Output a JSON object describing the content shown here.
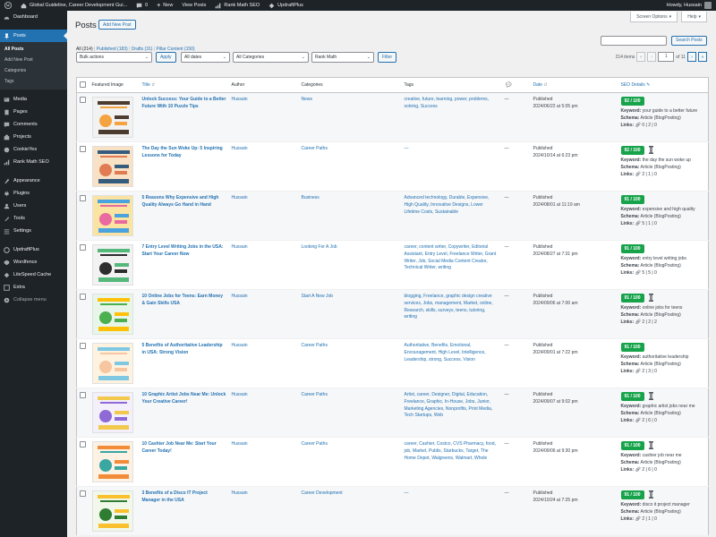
{
  "admin_bar": {
    "site_title": "Global Guideline, Career Development Gui...",
    "comments_count": "0",
    "new_label": "New",
    "view_posts_label": "View Posts",
    "rank_math_label": "Rank Math SEO",
    "updraft_label": "UpdraftPlus",
    "howdy": "Howdy, Hussain"
  },
  "sidebar": {
    "items": [
      {
        "label": "Dashboard",
        "icon": "dashboard-icon"
      },
      {
        "label": "Posts",
        "icon": "pin-icon"
      },
      {
        "label": "Media",
        "icon": "media-icon"
      },
      {
        "label": "Pages",
        "icon": "pages-icon"
      },
      {
        "label": "Comments",
        "icon": "comments-icon"
      },
      {
        "label": "Projects",
        "icon": "projects-icon"
      },
      {
        "label": "CookieYes",
        "icon": "cookie-icon"
      },
      {
        "label": "Rank Math SEO",
        "icon": "rank-math-icon"
      },
      {
        "label": "Appearance",
        "icon": "appearance-icon"
      },
      {
        "label": "Plugins",
        "icon": "plugins-icon"
      },
      {
        "label": "Users",
        "icon": "users-icon"
      },
      {
        "label": "Tools",
        "icon": "tools-icon"
      },
      {
        "label": "Settings",
        "icon": "settings-icon"
      },
      {
        "label": "UpdraftPlus",
        "icon": "updraft-icon"
      },
      {
        "label": "Wordfence",
        "icon": "wordfence-icon"
      },
      {
        "label": "LiteSpeed Cache",
        "icon": "litespeed-icon"
      },
      {
        "label": "Extra",
        "icon": "extra-icon"
      },
      {
        "label": "Collapse menu",
        "icon": "collapse-icon"
      }
    ],
    "posts_submenu": [
      "All Posts",
      "Add New Post",
      "Categories",
      "Tags"
    ]
  },
  "screen_options_label": "Screen Options",
  "help_label": "Help",
  "page_title": "Posts",
  "add_new_label": "Add New Post",
  "views": {
    "all": "All (214)",
    "published": "Published (183)",
    "drafts": "Drafts (31)",
    "pillar": "Pillar Content (150)"
  },
  "search_button": "Search Posts",
  "filters": {
    "bulk_actions": "Bulk actions",
    "apply": "Apply",
    "all_dates": "All dates",
    "all_categories": "All Categories",
    "rank_math": "Rank Math",
    "filter": "Filter"
  },
  "pagination": {
    "items": "214 items",
    "first": "«",
    "prev": "‹",
    "current": "1",
    "of": "of 11",
    "next": "›",
    "last": "»"
  },
  "columns": {
    "image": "Featured Image",
    "title": "Title",
    "author": "Author",
    "categories": "Categories",
    "tags": "Tags",
    "date": "Date",
    "seo": "SEO Details"
  },
  "seo_labels": {
    "keyword": "Keyword:",
    "schema": "Schema:",
    "links": "Links:"
  },
  "posts": [
    {
      "title": "Unlock Success: Your Guide to a Better Future With 10 Puzzle Tips",
      "author": "Hussain",
      "category": "News",
      "tags": "creative, future, learning, power, problems, solving, Success",
      "comments": "—",
      "status": "Published",
      "date": "2024/06/22 at 5:05 pm",
      "score": "92 / 100",
      "keyword": "your guide to a better future",
      "schema": "Article (BlogPosting)",
      "links": "0 | 2 | 0",
      "pillar": false,
      "colors": [
        "#f4a340",
        "#4c3b2f",
        "#f2f2f2"
      ]
    },
    {
      "title": "The Day the Sun Woke Up: 5 Inspiring Lessons for Today",
      "author": "Hussain",
      "category": "Career Paths",
      "tags": "—",
      "comments": "—",
      "status": "Published",
      "date": "2024/10/14 at 6:23 pm",
      "score": "92 / 100",
      "keyword": "the day the sun woke up",
      "schema": "Article (BlogPosting)",
      "links": "2 | 1 | 0",
      "pillar": true,
      "colors": [
        "#e07b52",
        "#355c7d",
        "#f8e1c4"
      ]
    },
    {
      "title": "5 Reasons Why Expensive and High Quality Always Go Hand in Hand",
      "author": "Hussain",
      "category": "Business",
      "tags": "Advanced technology, Durable, Expensive, High Quality, Innovative Designs, Lower Lifetime Costs, Sustainable",
      "comments": "—",
      "status": "Published",
      "date": "2024/08/01 at 11:19 am",
      "score": "91 / 100",
      "keyword": "expensive and high quality",
      "schema": "Article (BlogPosting)",
      "links": "5 | 1 | 0",
      "pillar": false,
      "colors": [
        "#e86aa0",
        "#4aa3df",
        "#fbe3a1"
      ]
    },
    {
      "title": "7 Entry Level Writing Jobs in the USA: Start Your Career Now",
      "author": "Hussain",
      "category": "Looking For A Job",
      "tags": "career, content writer, Copywriter, Editorial Assistant, Entry Level, Freelance Writer, Grant Writer, Job, Social Media Content Creator, Technical Writer, writing",
      "comments": "—",
      "status": "Published",
      "date": "2024/08/27 at 7:31 pm",
      "score": "91 / 100",
      "keyword": "entry level writing jobs",
      "schema": "Article (BlogPosting)",
      "links": "5 | 5 | 0",
      "pillar": false,
      "colors": [
        "#2d2d2d",
        "#54b87a",
        "#f2f2f2"
      ]
    },
    {
      "title": "10 Online Jobs for Teens: Earn Money & Gain Skills USA",
      "author": "Hussain",
      "category": "Start A New Job",
      "tags": "blogging, Freelance, graphic design creative services, Jobs, management, Market, online, Research, skills, surveys, teens, tutoring, writing",
      "comments": "—",
      "status": "Published",
      "date": "2024/09/06 at 7:00 am",
      "score": "91 / 100",
      "keyword": "online jobs for teens",
      "schema": "Article (BlogPosting)",
      "links": "2 | 2 | 2",
      "pillar": true,
      "colors": [
        "#4caf50",
        "#ffc107",
        "#e8f5e9"
      ]
    },
    {
      "title": "5 Benefits of Authoritative Leadership in USA: Strong Vision",
      "author": "Hussain",
      "category": "Career Paths",
      "tags": "Authoritative, Benefits, Emotional, Encouragement, High Level, Intelligence, Leadership, strong, Success, Vision",
      "comments": "—",
      "status": "Published",
      "date": "2024/09/01 at 7:22 pm",
      "score": "91 / 100",
      "keyword": "authoritative leadership",
      "schema": "Article (BlogPosting)",
      "links": "2 | 3 | 0",
      "pillar": false,
      "colors": [
        "#f7c59f",
        "#7ec8e3",
        "#fff3e0"
      ]
    },
    {
      "title": "10 Graphic Artist Jobs Near Me: Unlock Your Creative Career!",
      "author": "Hussain",
      "category": "Career Paths",
      "tags": "Artist, career, Designer, Digital, Education, Freelance, Graphic, In-House, Jobs, Junior, Marketing Agencies, Nonprofits, Print Media, Tech Startups, Web",
      "comments": "—",
      "status": "Published",
      "date": "2024/09/07 at 9:02 pm",
      "score": "91 / 100",
      "keyword": "graphic artist jobs near me",
      "schema": "Article (BlogPosting)",
      "links": "2 | 6 | 0",
      "pillar": true,
      "colors": [
        "#8e6ad6",
        "#f2c94c",
        "#f4f0fb"
      ]
    },
    {
      "title": "10 Cashier Job Near Me: Start Your Career Today!",
      "author": "Hussain",
      "category": "Career Paths",
      "tags": "career, Cashier, Costco, CVS Pharmacy, food, job, Market, Publix, Starbucks, Target, The Home Depot, Walgreens, Walmart, Whole",
      "comments": "—",
      "status": "Published",
      "date": "2024/09/06 at 9:30 pm",
      "score": "91 / 100",
      "keyword": "cashier job near me",
      "schema": "Article (BlogPosting)",
      "links": "2 | 6 | 0",
      "pillar": true,
      "colors": [
        "#3aa7a3",
        "#f28c38",
        "#fdf1e3"
      ]
    },
    {
      "title": "3 Benefits of a Disco IT Project Manager in the USA",
      "author": "Hussain",
      "category": "Career Development",
      "tags": "—",
      "comments": "—",
      "status": "Published",
      "date": "2024/10/24 at 7:25 pm",
      "score": "91 / 100",
      "keyword": "disco it project manager",
      "schema": "Article (BlogPosting)",
      "links": "2 | 1 | 0",
      "pillar": true,
      "colors": [
        "#2e7d32",
        "#fbc02d",
        "#f1f8e9"
      ]
    }
  ],
  "colors": {
    "admin_bar": "#1d2327",
    "accent": "#2271b1",
    "seo_good": "#16a34a"
  }
}
